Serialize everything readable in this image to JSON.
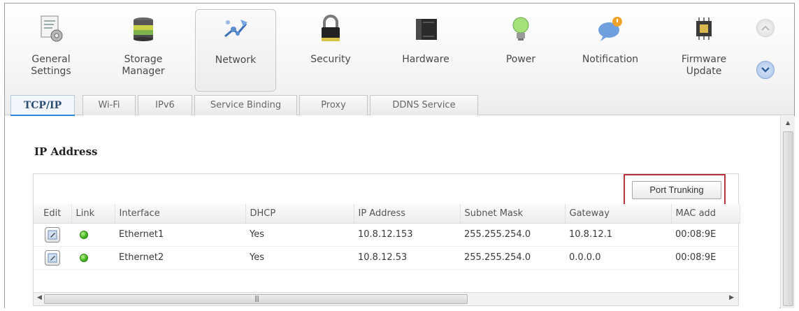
{
  "toolbar": {
    "items": [
      {
        "label": "General\nSettings",
        "icon": "general-settings-icon"
      },
      {
        "label": "Storage\nManager",
        "icon": "storage-manager-icon"
      },
      {
        "label": "Network",
        "icon": "network-icon",
        "active": true
      },
      {
        "label": "Security",
        "icon": "padlock-icon"
      },
      {
        "label": "Hardware",
        "icon": "hardware-icon"
      },
      {
        "label": "Power",
        "icon": "lightbulb-icon"
      },
      {
        "label": "Notification",
        "icon": "notification-bubble-icon"
      },
      {
        "label": "Firmware\nUpdate",
        "icon": "firmware-chip-icon"
      }
    ],
    "scroll_up_icon": "chevron-up-icon",
    "scroll_down_icon": "chevron-down-icon"
  },
  "tabs": [
    {
      "label": "TCP/IP",
      "active": true
    },
    {
      "label": "Wi-Fi"
    },
    {
      "label": "IPv6"
    },
    {
      "label": "Service Binding"
    },
    {
      "label": "Proxy"
    },
    {
      "label": "DDNS Service"
    }
  ],
  "section": {
    "title": "IP Address"
  },
  "actions": {
    "port_trunking": "Port Trunking"
  },
  "table": {
    "columns": [
      "Edit",
      "Link",
      "Interface",
      "DHCP",
      "IP Address",
      "Subnet Mask",
      "Gateway",
      "MAC add"
    ],
    "rows": [
      {
        "interface": "Ethernet1",
        "dhcp": "Yes",
        "ip": "10.8.12.153",
        "mask": "255.255.254.0",
        "gateway": "10.8.12.1",
        "mac": "00:08:9E"
      },
      {
        "interface": "Ethernet2",
        "dhcp": "Yes",
        "ip": "10.8.12.53",
        "mask": "255.255.254.0",
        "gateway": "0.0.0.0",
        "mac": "00:08:9E"
      }
    ]
  },
  "colors": {
    "active_tab_underline": "#2d87d8",
    "highlight_box": "#b7343b",
    "link_led": "#3fb21a"
  }
}
